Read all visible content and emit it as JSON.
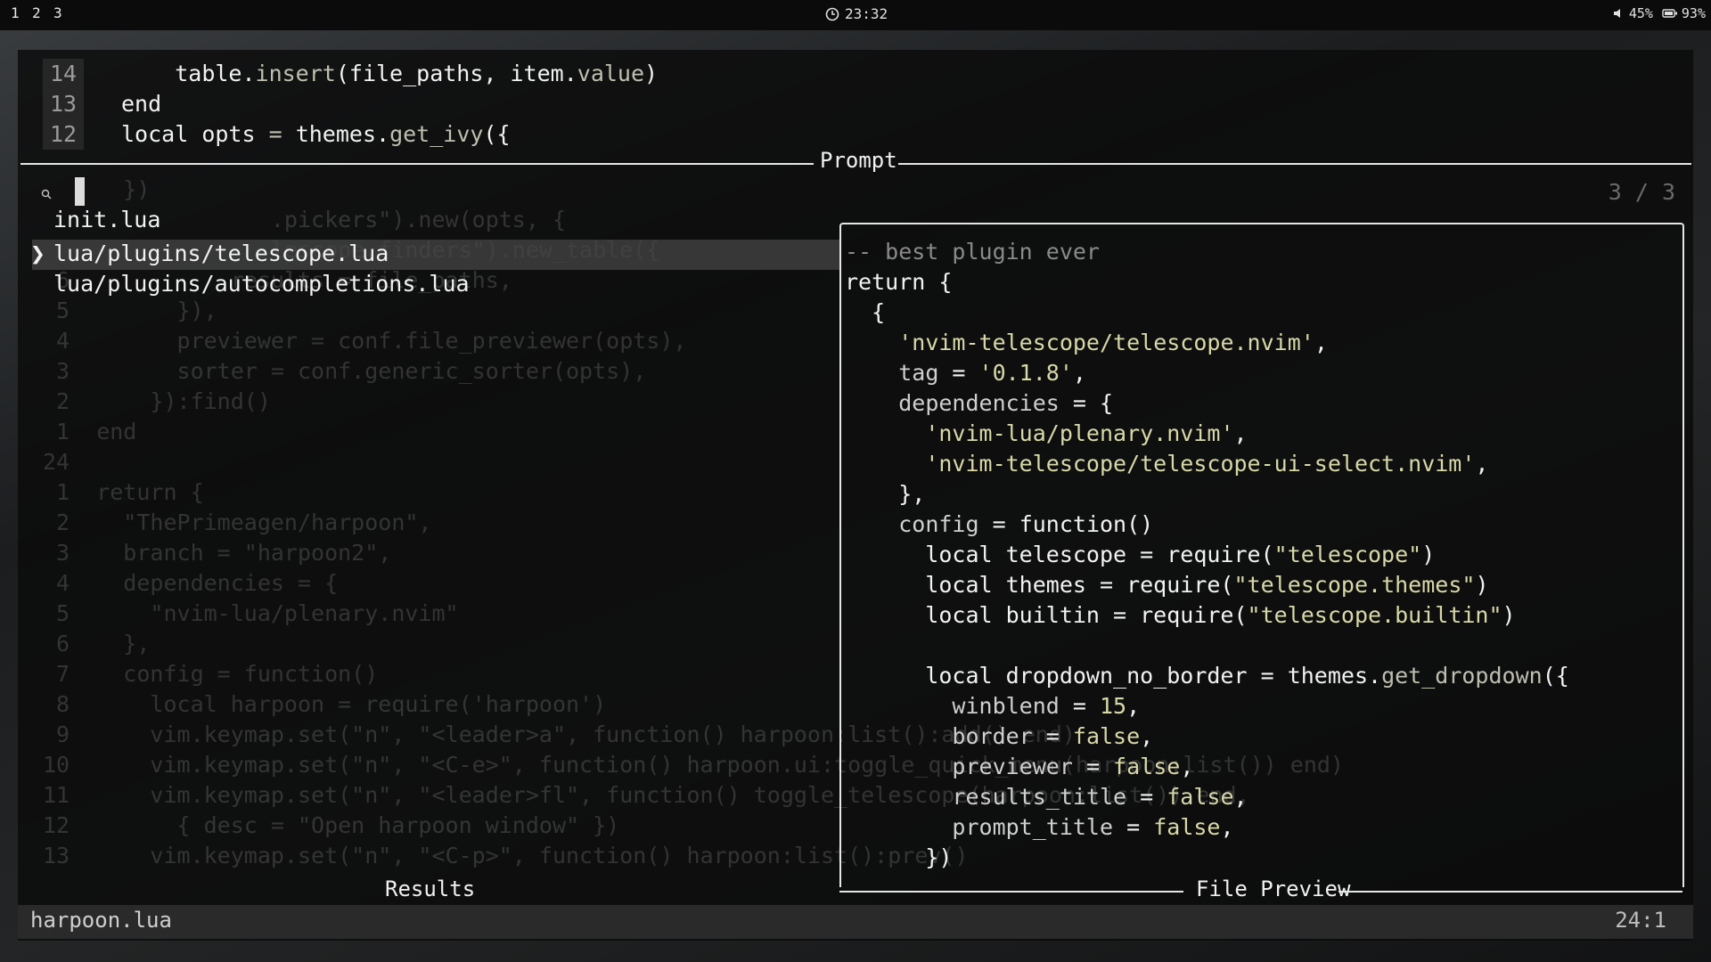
{
  "topbar": {
    "workspaces": [
      "1",
      "2",
      "3"
    ],
    "clock": "23:32",
    "clock_icon": "clock-icon",
    "volume": "45%",
    "volume_icon": "speaker-icon",
    "battery": "93%",
    "battery_icon": "battery-icon"
  },
  "editor_top": {
    "lines": [
      {
        "num": "14",
        "indent": "    ",
        "parts": [
          [
            "table.",
            "kw"
          ],
          [
            "insert",
            "fn"
          ],
          [
            "(file_paths, item.",
            "kw"
          ],
          [
            "value",
            "fn"
          ],
          [
            ")",
            "kw"
          ]
        ]
      },
      {
        "num": "13",
        "indent": "",
        "parts": [
          [
            "end",
            "kw"
          ]
        ]
      },
      {
        "num": "12",
        "indent": "",
        "parts": [
          [
            "local",
            "kw"
          ],
          [
            " opts ",
            "kw"
          ],
          [
            "=",
            "fn"
          ],
          [
            " themes.",
            "kw"
          ],
          [
            "get_ivy",
            "fn"
          ],
          [
            "({",
            "kw"
          ]
        ]
      }
    ]
  },
  "telescope": {
    "prompt_title": "Prompt",
    "count": "3 / 3",
    "search_icon": "magnifier-icon",
    "results": [
      "init.lua",
      "lua/plugins/telescope.lua",
      "lua/plugins/autocompletions.lua"
    ],
    "selected_index": 1,
    "results_title": "Results",
    "preview_title": "File Preview"
  },
  "background_code": [
    "      })",
    "                 .pickers\").new(opts, {",
    "                 lescope.finders\").new_table({",
    " 6            results = file_paths,",
    " 5        }),",
    " 4        previewer = conf.file_previewer(opts),",
    " 3        sorter = conf.generic_sorter(opts),",
    " 2      }):find()",
    " 1  end",
    "24",
    " 1  return {",
    " 2    \"ThePrimeagen/harpoon\",",
    " 3    branch = \"harpoon2\",",
    " 4    dependencies = {",
    " 5      \"nvim-lua/plenary.nvim\"",
    " 6    },",
    " 7    config = function()",
    " 8      local harpoon = require('harpoon')",
    " 9      vim.keymap.set(\"n\", \"<leader>a\", function() harpoon:list():add() end)",
    "10      vim.keymap.set(\"n\", \"<C-e>\", function() harpoon.ui:toggle_quick_menu(harpoon:list()) end)",
    "11      vim.keymap.set(\"n\", \"<leader>fl\", function() toggle_telescope(harpoon:list()) end,",
    "12        { desc = \"Open harpoon window\" })",
    "13      vim.keymap.set(\"n\", \"<C-p>\", function() harpoon:list():prev()"
  ],
  "preview_code": [
    [
      [
        "-- best plugin ever",
        "cm"
      ]
    ],
    [
      [
        "return",
        "kw"
      ],
      [
        " {",
        "kw"
      ]
    ],
    [
      [
        "  {",
        "kw"
      ]
    ],
    [
      [
        "    ",
        "kw"
      ],
      [
        "'nvim-telescope/telescope.nvim'",
        "str"
      ],
      [
        ",",
        "kw"
      ]
    ],
    [
      [
        "    ",
        "kw"
      ],
      [
        "tag",
        "key"
      ],
      [
        " = ",
        "kw"
      ],
      [
        "'0.1.8'",
        "str"
      ],
      [
        ",",
        "kw"
      ]
    ],
    [
      [
        "    ",
        "kw"
      ],
      [
        "dependencies",
        "key"
      ],
      [
        " = {",
        "kw"
      ]
    ],
    [
      [
        "      ",
        "kw"
      ],
      [
        "'nvim-lua/plenary.nvim'",
        "str"
      ],
      [
        ",",
        "kw"
      ]
    ],
    [
      [
        "      ",
        "kw"
      ],
      [
        "'nvim-telescope/telescope-ui-select.nvim'",
        "str"
      ],
      [
        ",",
        "kw"
      ]
    ],
    [
      [
        "    },",
        "kw"
      ]
    ],
    [
      [
        "    ",
        "kw"
      ],
      [
        "config",
        "key"
      ],
      [
        " = ",
        "kw"
      ],
      [
        "function",
        "kw"
      ],
      [
        "()",
        "kw"
      ]
    ],
    [
      [
        "      local telescope = require(",
        "kw"
      ],
      [
        "\"telescope\"",
        "str"
      ],
      [
        ")",
        "kw"
      ]
    ],
    [
      [
        "      local themes = require(",
        "kw"
      ],
      [
        "\"telescope.themes\"",
        "str"
      ],
      [
        ")",
        "kw"
      ]
    ],
    [
      [
        "      local builtin = require(",
        "kw"
      ],
      [
        "\"telescope.builtin\"",
        "str"
      ],
      [
        ")",
        "kw"
      ]
    ],
    [
      [
        "",
        "kw"
      ]
    ],
    [
      [
        "      local dropdown_no_border = themes.",
        "kw"
      ],
      [
        "get_dropdown",
        "fn"
      ],
      [
        "({",
        "kw"
      ]
    ],
    [
      [
        "        ",
        "kw"
      ],
      [
        "winblend",
        "key"
      ],
      [
        " = ",
        "kw"
      ],
      [
        "15",
        "str"
      ],
      [
        ",",
        "kw"
      ]
    ],
    [
      [
        "        ",
        "kw"
      ],
      [
        "border",
        "key"
      ],
      [
        " = ",
        "kw"
      ],
      [
        "false",
        "str"
      ],
      [
        ",",
        "kw"
      ]
    ],
    [
      [
        "        ",
        "kw"
      ],
      [
        "previewer",
        "key"
      ],
      [
        " = ",
        "kw"
      ],
      [
        "false",
        "str"
      ],
      [
        ",",
        "kw"
      ]
    ],
    [
      [
        "        ",
        "kw"
      ],
      [
        "results_title",
        "key"
      ],
      [
        " = ",
        "kw"
      ],
      [
        "false",
        "str"
      ],
      [
        ",",
        "kw"
      ]
    ],
    [
      [
        "        ",
        "kw"
      ],
      [
        "prompt_title",
        "key"
      ],
      [
        " = ",
        "kw"
      ],
      [
        "false",
        "str"
      ],
      [
        ",",
        "kw"
      ]
    ],
    [
      [
        "      })",
        "kw"
      ]
    ]
  ],
  "statusline": {
    "filename": "harpoon.lua",
    "position": "24:1"
  }
}
